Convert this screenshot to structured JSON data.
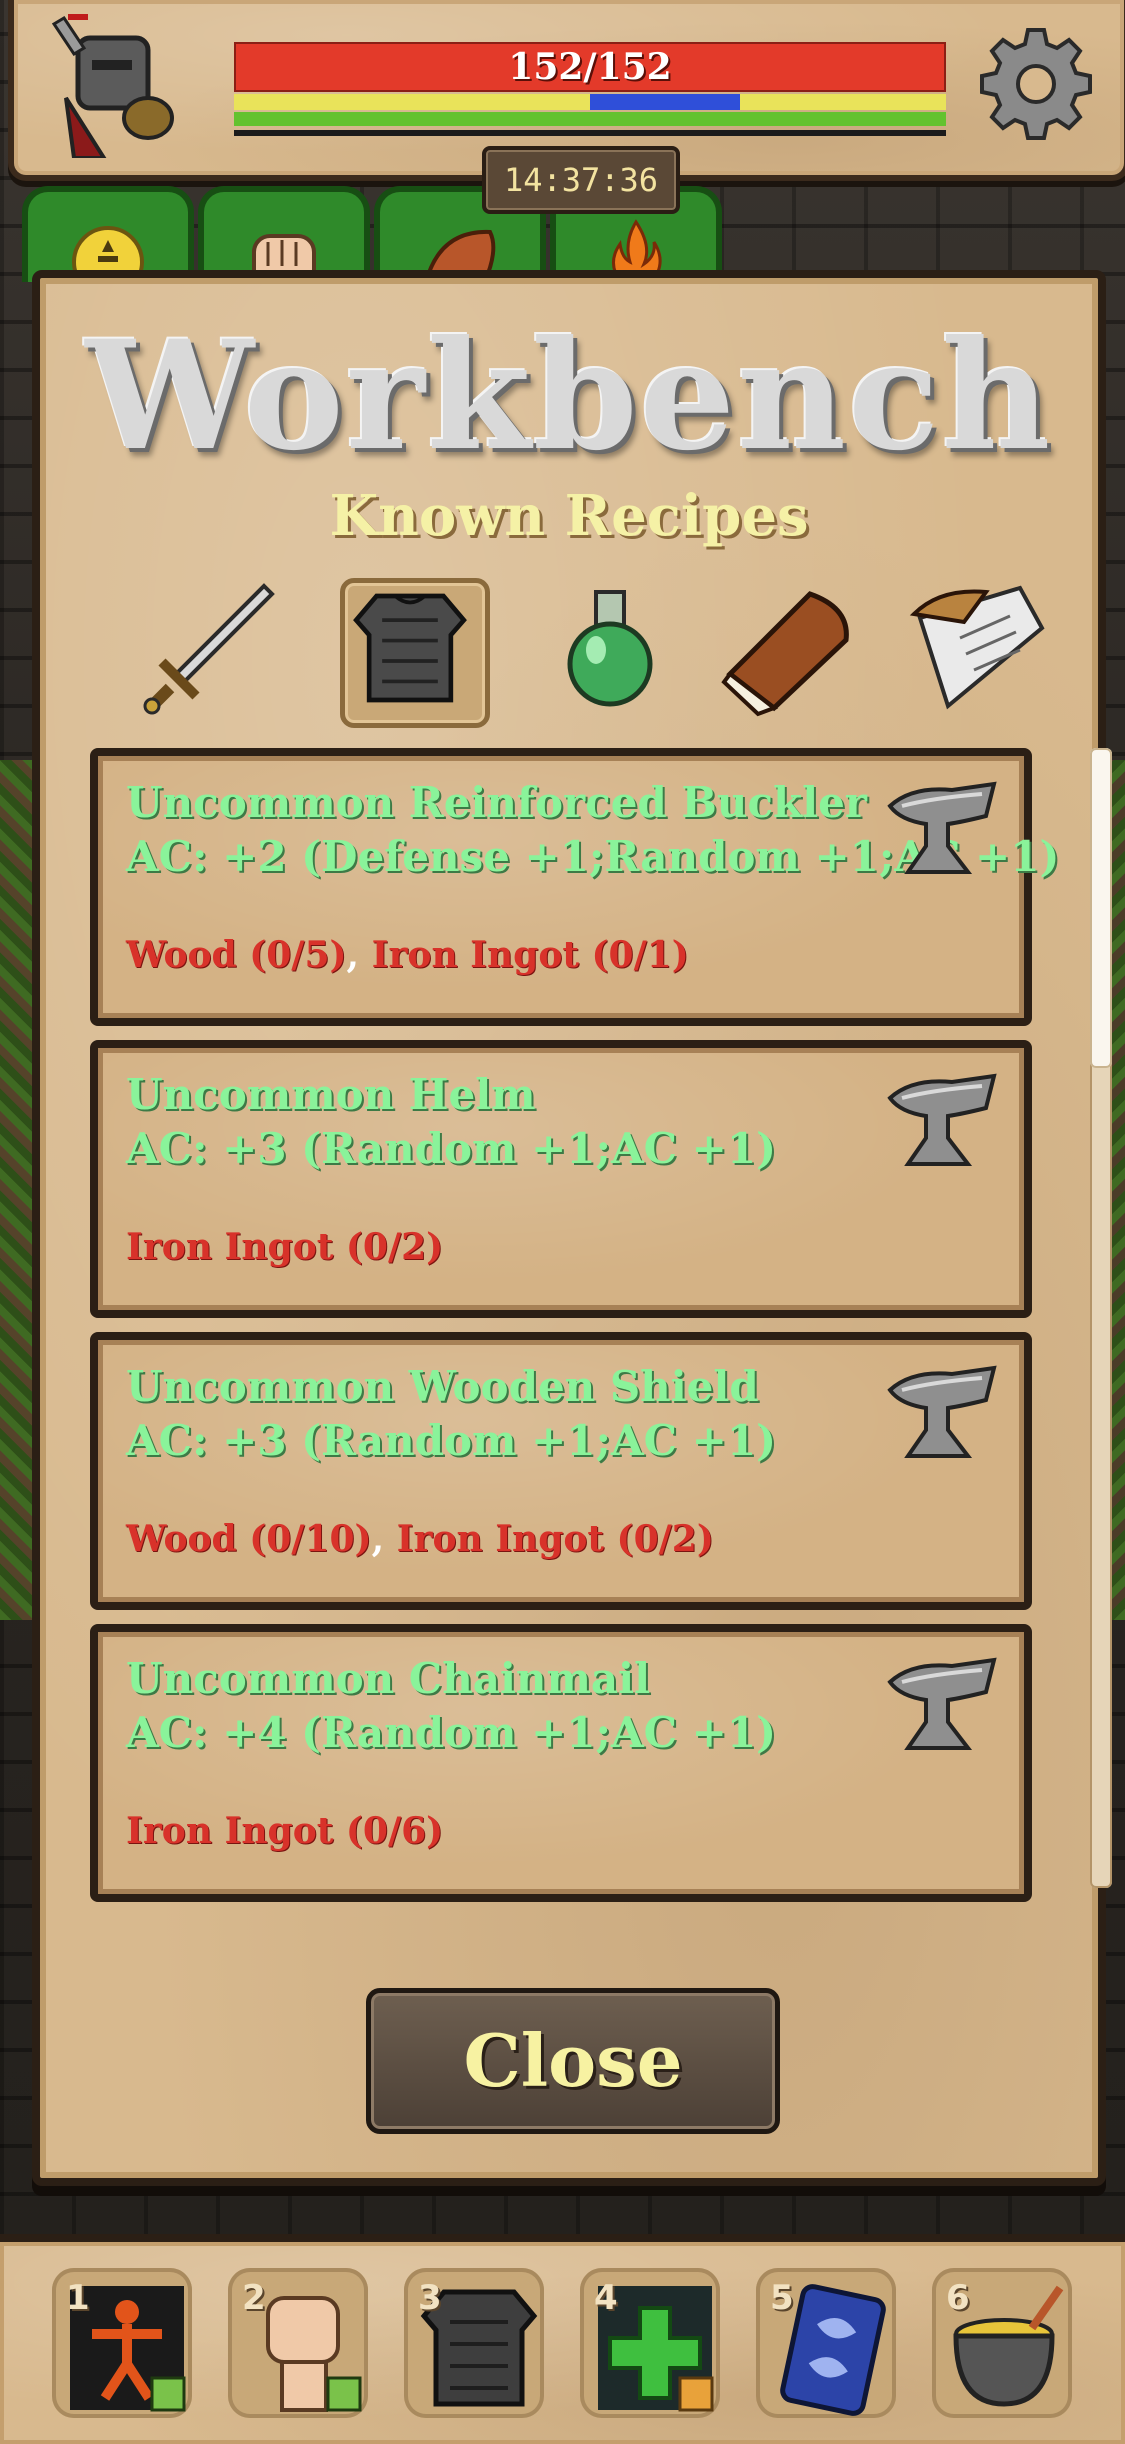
{
  "hud": {
    "hp_text": "152/152",
    "hp_fraction": 1.0,
    "mana_fill_start": 0.5,
    "mana_fill_end": 0.71,
    "clock": "14:37:36"
  },
  "category_tabs": [
    {
      "icon": "sun-icon"
    },
    {
      "icon": "fist-icon"
    },
    {
      "icon": "bread-icon"
    },
    {
      "icon": "campfire-icon"
    }
  ],
  "panel": {
    "title": "Workbench",
    "subtitle": "Known Recipes",
    "filters": [
      {
        "icon": "sword-icon",
        "selected": false
      },
      {
        "icon": "armor-icon",
        "selected": true
      },
      {
        "icon": "potion-icon",
        "selected": false
      },
      {
        "icon": "bread-icon",
        "selected": false
      },
      {
        "icon": "scroll-icon",
        "selected": false
      }
    ],
    "close_label": "Close"
  },
  "recipes": [
    {
      "name": "Uncommon Reinforced Buckler",
      "stats": "AC: +2 (Defense +1;Random +1;AC +1)",
      "reqs": [
        {
          "text": "Wood (0/5)"
        },
        {
          "text": "Iron Ingot (0/1)"
        }
      ]
    },
    {
      "name": "Uncommon Helm",
      "stats": "AC: +3 (Random +1;AC +1)",
      "reqs": [
        {
          "text": "Iron Ingot (0/2)"
        }
      ]
    },
    {
      "name": "Uncommon Wooden Shield",
      "stats": "AC: +3 (Random +1;AC +1)",
      "reqs": [
        {
          "text": "Wood (0/10)"
        },
        {
          "text": "Iron Ingot (0/2)"
        }
      ]
    },
    {
      "name": "Uncommon Chainmail",
      "stats": "AC: +4 (Random +1;AC +1)",
      "reqs": [
        {
          "text": "Iron Ingot (0/6)"
        }
      ]
    }
  ],
  "hotbar": [
    {
      "num": "1",
      "icon": "skills-figure-icon"
    },
    {
      "num": "2",
      "icon": "fist-icon"
    },
    {
      "num": "3",
      "icon": "armor-icon"
    },
    {
      "num": "4",
      "icon": "health-cross-icon"
    },
    {
      "num": "5",
      "icon": "card-icon"
    },
    {
      "num": "6",
      "icon": "cauldron-icon"
    }
  ],
  "colors": {
    "hp": "#e33a2a",
    "mana": "#2f4fd9",
    "stamina": "#e9e35a",
    "xp": "#63c22f",
    "recipe_text": "#8af39a",
    "missing_req": "#d8322a"
  }
}
